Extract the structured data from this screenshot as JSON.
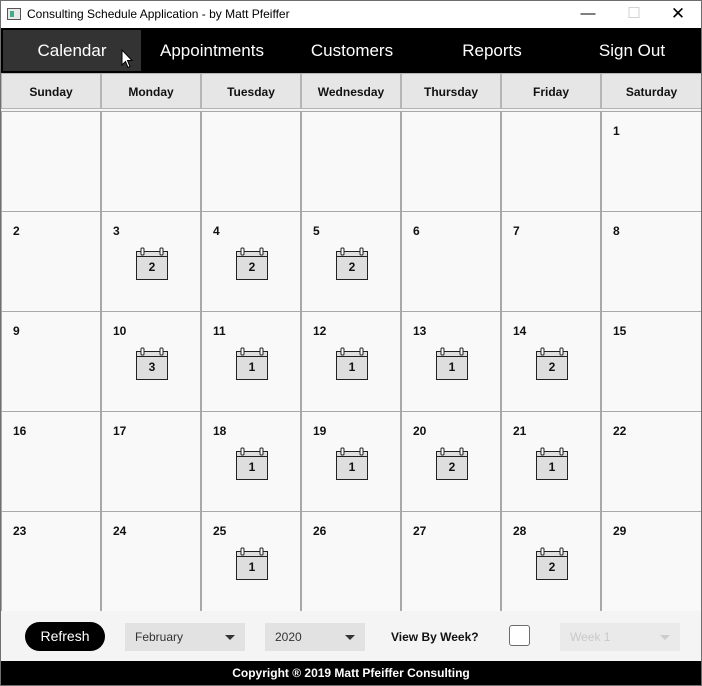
{
  "window": {
    "title": "Consulting Schedule Application - by Matt Pfeiffer",
    "minimize": "—",
    "maximize": "☐",
    "close": "✕"
  },
  "nav": {
    "calendar": "Calendar",
    "appointments": "Appointments",
    "customers": "Customers",
    "reports": "Reports",
    "sign_out": "Sign Out"
  },
  "calendar": {
    "days": [
      "Sunday",
      "Monday",
      "Tuesday",
      "Wednesday",
      "Thursday",
      "Friday",
      "Saturday"
    ],
    "weeks": [
      [
        {
          "day": "",
          "count": null
        },
        {
          "day": "",
          "count": null
        },
        {
          "day": "",
          "count": null
        },
        {
          "day": "",
          "count": null
        },
        {
          "day": "",
          "count": null
        },
        {
          "day": "",
          "count": null
        },
        {
          "day": "1",
          "count": null
        }
      ],
      [
        {
          "day": "2",
          "count": null
        },
        {
          "day": "3",
          "count": "2"
        },
        {
          "day": "4",
          "count": "2"
        },
        {
          "day": "5",
          "count": "2"
        },
        {
          "day": "6",
          "count": null
        },
        {
          "day": "7",
          "count": null
        },
        {
          "day": "8",
          "count": null
        }
      ],
      [
        {
          "day": "9",
          "count": null
        },
        {
          "day": "10",
          "count": "3"
        },
        {
          "day": "11",
          "count": "1"
        },
        {
          "day": "12",
          "count": "1"
        },
        {
          "day": "13",
          "count": "1"
        },
        {
          "day": "14",
          "count": "2"
        },
        {
          "day": "15",
          "count": null
        }
      ],
      [
        {
          "day": "16",
          "count": null
        },
        {
          "day": "17",
          "count": null
        },
        {
          "day": "18",
          "count": "1"
        },
        {
          "day": "19",
          "count": "1"
        },
        {
          "day": "20",
          "count": "2"
        },
        {
          "day": "21",
          "count": "1"
        },
        {
          "day": "22",
          "count": null
        }
      ],
      [
        {
          "day": "23",
          "count": null
        },
        {
          "day": "24",
          "count": null
        },
        {
          "day": "25",
          "count": "1"
        },
        {
          "day": "26",
          "count": null
        },
        {
          "day": "27",
          "count": null
        },
        {
          "day": "28",
          "count": "2"
        },
        {
          "day": "29",
          "count": null
        }
      ]
    ]
  },
  "toolbar": {
    "refresh": "Refresh",
    "month": "February",
    "year": "2020",
    "view_by_week": "View By Week?",
    "view_by_week_checked": false,
    "week": "Week 1"
  },
  "footer": {
    "copyright": "Copyright ® 2019 Matt Pfeiffer Consulting"
  }
}
